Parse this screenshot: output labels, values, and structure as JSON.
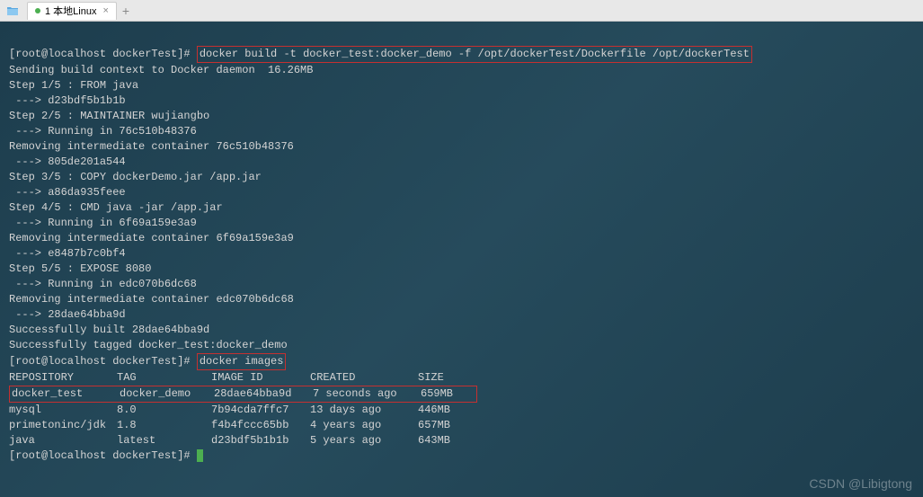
{
  "tab": {
    "label": "1 本地Linux"
  },
  "prompt": "[root@localhost dockerTest]#",
  "cmd1": "docker build -t docker_test:docker_demo -f /opt/dockerTest/Dockerfile /opt/dockerTest",
  "build_output": [
    "Sending build context to Docker daemon  16.26MB",
    "Step 1/5 : FROM java",
    " ---> d23bdf5b1b1b",
    "Step 2/5 : MAINTAINER wujiangbo",
    " ---> Running in 76c510b48376",
    "Removing intermediate container 76c510b48376",
    " ---> 805de201a544",
    "Step 3/5 : COPY dockerDemo.jar /app.jar",
    " ---> a86da935feee",
    "Step 4/5 : CMD java -jar /app.jar",
    " ---> Running in 6f69a159e3a9",
    "Removing intermediate container 6f69a159e3a9",
    " ---> e8487b7c0bf4",
    "Step 5/5 : EXPOSE 8080",
    " ---> Running in edc070b6dc68",
    "Removing intermediate container edc070b6dc68",
    " ---> 28dae64bba9d",
    "Successfully built 28dae64bba9d",
    "Successfully tagged docker_test:docker_demo"
  ],
  "cmd2": "docker images",
  "table": {
    "headers": {
      "repo": "REPOSITORY",
      "tag": "TAG",
      "imgid": "IMAGE ID",
      "created": "CREATED",
      "size": "SIZE"
    },
    "rows": [
      {
        "repo": "docker_test",
        "tag": "docker_demo",
        "imgid": "28dae64bba9d",
        "created": "7 seconds ago",
        "size": "659MB"
      },
      {
        "repo": "mysql",
        "tag": "8.0",
        "imgid": "7b94cda7ffc7",
        "created": "13 days ago",
        "size": "446MB"
      },
      {
        "repo": "primetoninc/jdk",
        "tag": "1.8",
        "imgid": "f4b4fccc65bb",
        "created": "4 years ago",
        "size": "657MB"
      },
      {
        "repo": "java",
        "tag": "latest",
        "imgid": "d23bdf5b1b1b",
        "created": "5 years ago",
        "size": "643MB"
      }
    ]
  },
  "watermark": "CSDN @Libigtong"
}
